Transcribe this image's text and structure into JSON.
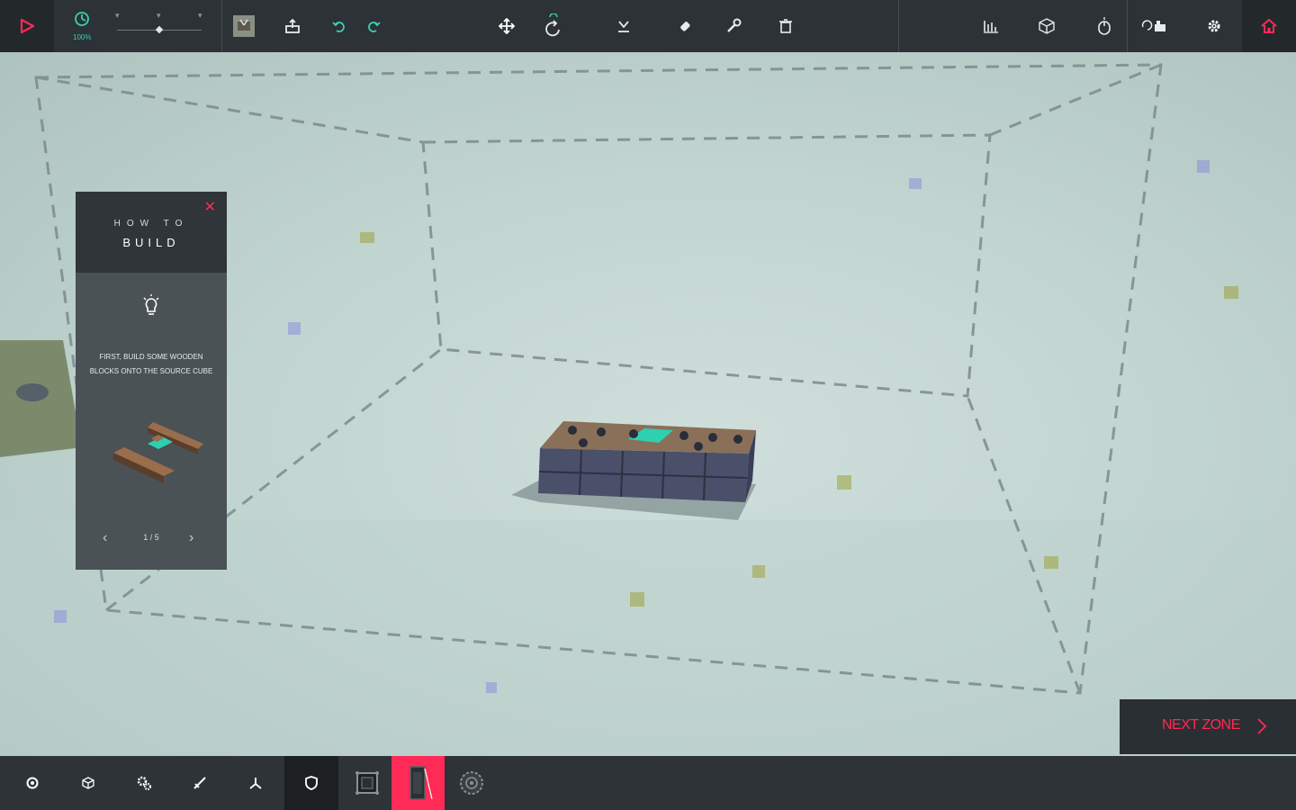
{
  "timescale": {
    "value_label": "100%"
  },
  "toolbar": {
    "play": "play-icon",
    "timescale": "clock-icon",
    "items": [
      "machine-icon",
      "load-icon",
      "undo-icon",
      "redo-icon",
      "move-icon",
      "rotate-icon",
      "drop-icon",
      "eraser-icon",
      "wrench-icon",
      "trash-icon",
      "stats-icon",
      "cube-icon",
      "mouse-icon",
      "switch-icon",
      "settings-icon",
      "home-icon"
    ]
  },
  "tutorial": {
    "line1": "HOW TO",
    "line2": "BUILD",
    "close": "✕",
    "instruction_line1": "FIRST, BUILD SOME WOODEN",
    "instruction_line2": "BLOCKS ONTO THE SOURCE CUBE",
    "page": "1 / 5"
  },
  "next_zone": {
    "label": "NEXT ZONE"
  },
  "bottom_bar": {
    "items": [
      "basic-blocks-icon",
      "blocks-icon",
      "mechanical-icon",
      "weapons-icon",
      "flight-icon",
      "armour-icon",
      "frame-block-icon",
      "selected-block-icon",
      "wheel-icon"
    ],
    "selected": "selected-block-icon"
  },
  "colors": {
    "accent": "#ff2a55",
    "teal": "#3ccfb4",
    "bar": "#2c3236"
  }
}
